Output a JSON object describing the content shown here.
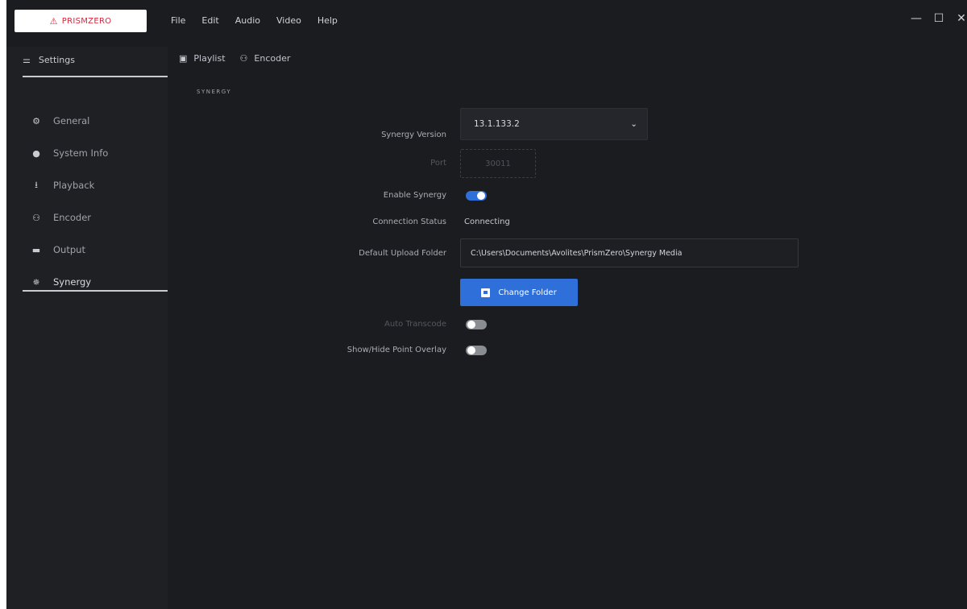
{
  "brand": {
    "warn_icon": "warning-triangle-icon",
    "name": "PRISMZERO"
  },
  "menu": [
    "File",
    "Edit",
    "Audio",
    "Video",
    "Help"
  ],
  "window_controls": {
    "minimize": "—",
    "maximize": "☐",
    "close": "✕"
  },
  "sidebar": {
    "header": "Settings",
    "items": [
      {
        "label": "General",
        "icon": "gear-icon"
      },
      {
        "label": "System Info",
        "icon": "info-icon"
      },
      {
        "label": "Playback",
        "icon": "playback-icon"
      },
      {
        "label": "Encoder",
        "icon": "encoder-icon"
      },
      {
        "label": "Output",
        "icon": "output-icon"
      },
      {
        "label": "Synergy",
        "icon": "synergy-icon",
        "active": true
      }
    ]
  },
  "tabs": [
    {
      "label": "Playlist",
      "icon": "playlist-icon"
    },
    {
      "label": "Encoder",
      "icon": "encoder-icon"
    }
  ],
  "synergy": {
    "section_title": "SYNERGY",
    "version_label": "Synergy Version",
    "version_value": "13.1.133.2",
    "port_label": "Port",
    "port_value": "30011",
    "enable_label": "Enable Synergy",
    "enable_state": true,
    "connection_label": "Connection Status",
    "connection_value": "Connecting",
    "folder_label": "Default Upload Folder",
    "folder_value": "C:\\Users\\Documents\\Avolites\\PrismZero\\Synergy Media",
    "change_folder_label": "Change Folder",
    "auto_transcode_label": "Auto Transcode",
    "auto_transcode_state": false,
    "point_overlay_label": "Show/Hide Point Overlay",
    "point_overlay_state": false
  },
  "colors": {
    "accent": "#2f6fd9",
    "brand_red": "#e0233a",
    "background": "#1b1c20"
  }
}
